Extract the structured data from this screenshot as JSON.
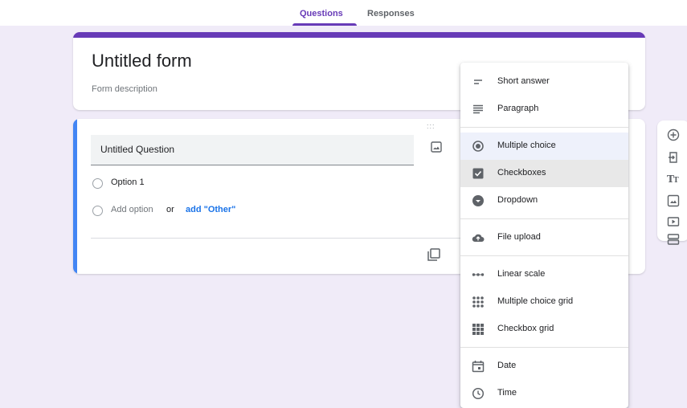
{
  "tabs": {
    "questions": "Questions",
    "responses": "Responses"
  },
  "header": {
    "title": "Untitled form",
    "description": "Form description"
  },
  "question": {
    "title": "Untitled Question",
    "option1": "Option 1",
    "add_option": "Add option",
    "or_text": "or",
    "add_other": "add \"Other\"",
    "drag_handle": ":::"
  },
  "menu": {
    "items": [
      {
        "label": "Short answer",
        "icon": "short-text-icon"
      },
      {
        "label": "Paragraph",
        "icon": "paragraph-icon"
      },
      {
        "label": "Multiple choice",
        "icon": "radio-button-icon"
      },
      {
        "label": "Checkboxes",
        "icon": "checkbox-icon"
      },
      {
        "label": "Dropdown",
        "icon": "dropdown-icon"
      },
      {
        "label": "File upload",
        "icon": "cloud-upload-icon"
      },
      {
        "label": "Linear scale",
        "icon": "linear-scale-icon"
      },
      {
        "label": "Multiple choice grid",
        "icon": "radio-grid-icon"
      },
      {
        "label": "Checkbox grid",
        "icon": "checkbox-grid-icon"
      },
      {
        "label": "Date",
        "icon": "calendar-icon"
      },
      {
        "label": "Time",
        "icon": "clock-icon"
      }
    ],
    "selected": "Multiple choice"
  },
  "side_toolbar": {
    "items": [
      "add-question-icon",
      "import-questions-icon",
      "add-title-icon",
      "add-image-icon",
      "add-video-icon",
      "add-section-icon"
    ]
  },
  "colors": {
    "accent": "#673ab7",
    "question_bar": "#4285f4",
    "link": "#1a73e8",
    "background": "#f0ebf8"
  }
}
